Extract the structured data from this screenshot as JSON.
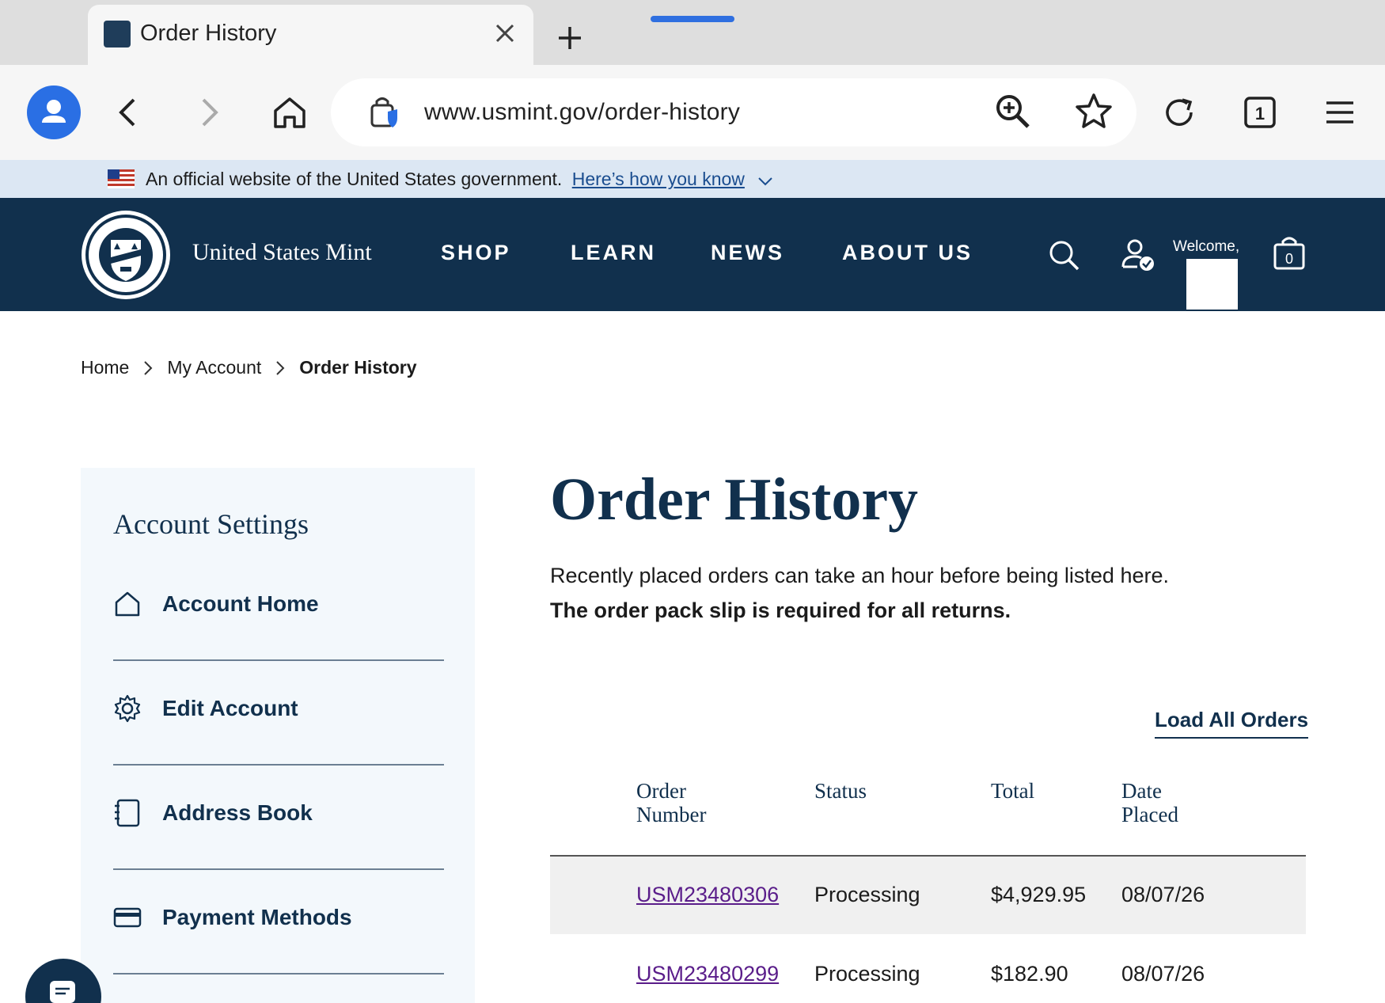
{
  "browser": {
    "tab_title": "Order History",
    "url": "www.usmint.gov/order-history",
    "tab_count": "1"
  },
  "gov_banner": {
    "text": "An official website of the United States government.",
    "link": "Here’s how you know"
  },
  "site_nav": {
    "brand": "United States Mint",
    "links": [
      "SHOP",
      "LEARN",
      "NEWS",
      "ABOUT US"
    ],
    "welcome": "Welcome,",
    "cart_count": "0"
  },
  "breadcrumb": {
    "items": [
      "Home",
      "My Account"
    ],
    "current": "Order History"
  },
  "sidebar": {
    "title": "Account Settings",
    "items": [
      {
        "label": "Account Home",
        "icon": "home-icon"
      },
      {
        "label": "Edit Account",
        "icon": "gear-icon"
      },
      {
        "label": "Address Book",
        "icon": "address-book-icon"
      },
      {
        "label": "Payment Methods",
        "icon": "credit-card-icon"
      }
    ]
  },
  "main": {
    "title": "Order History",
    "note": "Recently placed orders can take an hour before being listed here.",
    "note_bold": "The order pack slip is required for all returns.",
    "load_all": "Load All Orders"
  },
  "orders_table": {
    "headers": [
      {
        "line1": "Order",
        "line2": "Number"
      },
      {
        "line1": "Status",
        "line2": ""
      },
      {
        "line1": "Total",
        "line2": ""
      },
      {
        "line1": "Date",
        "line2": "Placed"
      }
    ],
    "rows": [
      {
        "order_number": "USM23480306",
        "status": "Processing",
        "total": "$4,929.95",
        "date": "08/07/26"
      },
      {
        "order_number": "USM23480299",
        "status": "Processing",
        "total": "$182.90",
        "date": "08/07/26"
      }
    ]
  },
  "colors": {
    "navy": "#11304d",
    "link_purple": "#5a1d8a",
    "banner_bg": "#dce7f3",
    "browser_accent": "#2a6fe4"
  }
}
